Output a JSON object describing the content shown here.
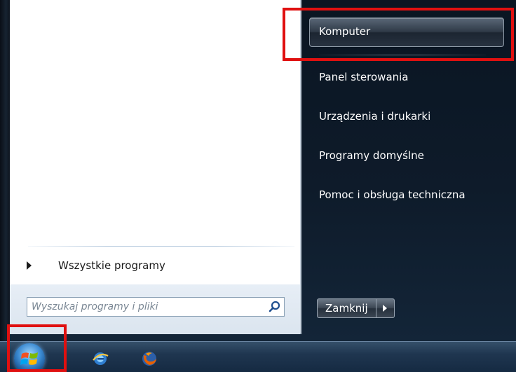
{
  "start_menu": {
    "all_programs_label": "Wszystkie programy",
    "search_placeholder": "Wyszukaj programy i pliki",
    "right_items": [
      "Komputer",
      "Panel sterowania",
      "Urządzenia i drukarki",
      "Programy domyślne",
      "Pomoc i obsługa techniczna"
    ],
    "shutdown_label": "Zamknij"
  },
  "taskbar": {
    "icons": [
      "start-orb-icon",
      "ie-icon",
      "firefox-icon"
    ]
  },
  "colors": {
    "highlight": "#e01010",
    "menu_dark": "#0e1b2a",
    "taskbar": "#1f3650"
  }
}
